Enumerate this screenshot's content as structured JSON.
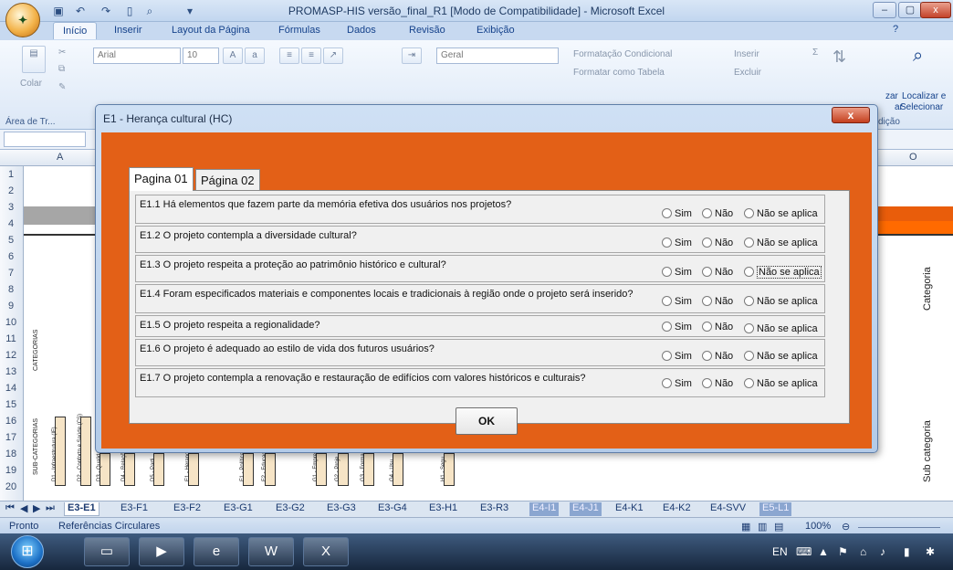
{
  "window": {
    "title": "PROMASP-HIS versão_final_R1  [Modo de Compatibilidade] - Microsoft Excel",
    "minimize": "–",
    "maximize": "▢",
    "close": "x"
  },
  "ribbon": {
    "tabs": [
      "Início",
      "Inserir",
      "Layout da Página",
      "Fórmulas",
      "Dados",
      "Revisão",
      "Exibição"
    ],
    "font_name": "Arial",
    "font_size": "10",
    "number_format": "Geral",
    "paste_label": "Colar",
    "clipboard_group": "Área de Tr...",
    "cond_format": "Formatação Condicional",
    "format_table": "Formatar como Tabela",
    "insert": "Inserir",
    "delete": "Excluir",
    "find_label": "Localizar e",
    "select_label": "Selecionar",
    "edit_group": "dição",
    "sort_fragment": "zar",
    "sort_fragment2": "ar"
  },
  "grid": {
    "col_first": "A",
    "col_last": "O",
    "rows": [
      "1",
      "2",
      "3",
      "4",
      "5",
      "6",
      "7",
      "8",
      "9",
      "10",
      "11",
      "12",
      "13",
      "14",
      "15",
      "16",
      "17",
      "18",
      "19",
      "20"
    ],
    "categoria": "Categoria",
    "sub_categoria": "Sub categoria",
    "categorias_small": "CATEGORIAS",
    "sub_categorias_small": "SUB-CATEGORIAS",
    "subcats": [
      "D1 - Infraestrutura (IF)",
      "D2 - Conforto e Saúde (CS)",
      "D3 - Qualidade",
      "D4 - Relações Comunidade",
      "D5 - Parti",
      "E1 - Herança",
      "F1 - Políticas",
      "F2 - Educação",
      "G1 - Empresa",
      "G2 - Proje",
      "G3 - Forma Empresa do",
      "G4 - Usu",
      "H1 - Segu"
    ]
  },
  "sheets": {
    "tabs": [
      "E3-E1",
      "E3-F1",
      "E3-F2",
      "E3-G1",
      "E3-G2",
      "E3-G3",
      "E3-G4",
      "E3-H1",
      "E3-R3",
      "E4-I1",
      "E4-J1",
      "E4-K1",
      "E4-K2",
      "E4-SVV",
      "E5-L1"
    ],
    "active": "E3-E1"
  },
  "status": {
    "ready": "Pronto",
    "circular": "Referências Circulares",
    "zoom": "100%"
  },
  "taskbar": {
    "lang": "EN"
  },
  "dialog": {
    "title": "E1 - Herança cultural (HC)",
    "close": "x",
    "tabs": [
      "Pagina 01",
      "Página 02"
    ],
    "options": [
      "Sim",
      "Não",
      "Não se aplica"
    ],
    "questions": [
      "E1.1 Há elementos que fazem parte da memória efetiva dos usuários nos projetos?",
      "E1.2 O projeto contempla a diversidade cultural?",
      "E1.3 O projeto respeita a proteção ao patrimônio histórico e cultural?",
      "E1.4 Foram especificados materiais e componentes locais e tradicionais à região onde o projeto será inserido?",
      "E1.5 O projeto respeita a regionalidade?",
      "E1.6 O projeto é adequado ao estilo de vida dos futuros usuários?",
      "E1.7 O projeto contempla a renovação e restauração de edifícios com valores históricos e culturais?"
    ],
    "ok": "OK"
  }
}
